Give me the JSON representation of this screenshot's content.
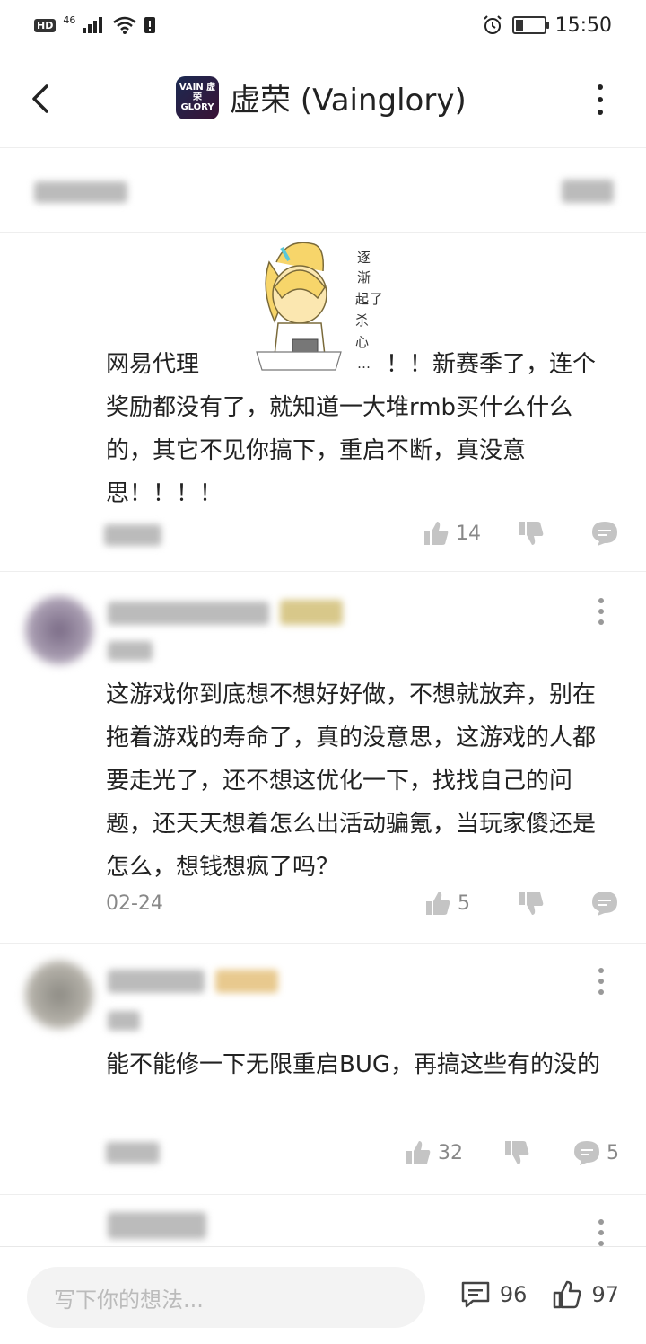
{
  "status_bar": {
    "network": "46",
    "time": "15:50",
    "battery_level": 0.3
  },
  "header": {
    "app_logo_line1": "VAIN 虚荣",
    "app_logo_line2": "GLORY",
    "title": "虚荣 (Vainglory)"
  },
  "post": {
    "text_line1_prefix": "网易代理",
    "text_line1_suffix": "！！新赛季了，连个",
    "text_rest": "奖励都没有了，就知道一大堆rmb买什么什么的，其它不见你搞下，重启不断，真没意思！！！！",
    "sticker_caption": "逐渐起了杀心…",
    "likes": "14"
  },
  "comments": [
    {
      "text": "这游戏你到底想不想好好做，不想就放弃，别在拖着游戏的寿命了，真的没意思，这游戏的人都要走光了，还不想这优化一下，找找自己的问题，还天天想着怎么出活动骗氪，当玩家傻还是怎么，想钱想疯了吗？",
      "date": "02-24",
      "likes": "5"
    },
    {
      "text": "能不能修一下无限重启BUG，再搞这些有的没的",
      "likes": "32",
      "replies": "5"
    }
  ],
  "bottom_bar": {
    "input_placeholder": "写下你的想法...",
    "comment_count": "96",
    "like_count": "97"
  },
  "icons": {
    "back": "chevron-left-icon",
    "more": "vertical-dots-icon",
    "like": "thumbs-up-icon",
    "dislike": "thumbs-down-icon",
    "comment": "chat-bubble-icon"
  }
}
